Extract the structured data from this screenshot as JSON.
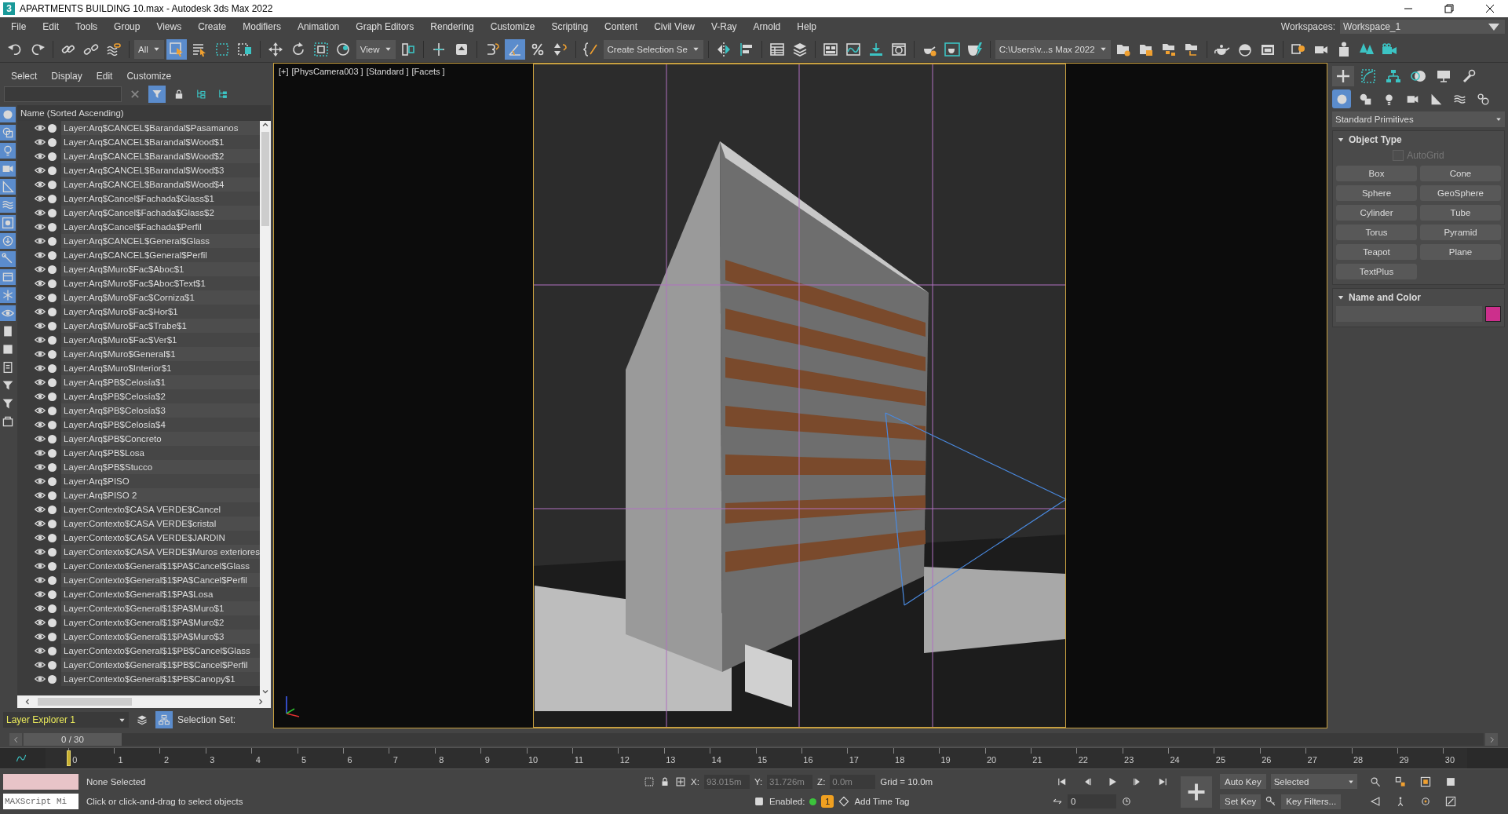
{
  "window": {
    "logo_text": "3",
    "title": "APARTMENTS BUILDING 10.max - Autodesk 3ds Max 2022"
  },
  "menu": [
    "File",
    "Edit",
    "Tools",
    "Group",
    "Views",
    "Create",
    "Modifiers",
    "Animation",
    "Graph Editors",
    "Rendering",
    "Customize",
    "Scripting",
    "Content",
    "Civil View",
    "V-Ray",
    "Arnold",
    "Help"
  ],
  "workspaces": {
    "label": "Workspaces:",
    "value": "Workspace_1"
  },
  "toolbar": [
    [
      {
        "kind": "button",
        "selected": false
      },
      {
        "kind": "button",
        "selected": false
      }
    ],
    [
      {
        "kind": "button",
        "selected": false
      },
      {
        "kind": "button",
        "selected": false
      },
      {
        "kind": "button",
        "selected": false
      }
    ],
    [
      {
        "kind": "dropdown",
        "value": "All"
      },
      {
        "kind": "button",
        "selected": true
      },
      {
        "kind": "button",
        "selected": false
      },
      {
        "kind": "button",
        "selected": false
      },
      {
        "kind": "button",
        "selected": false
      }
    ],
    [
      {
        "kind": "button",
        "selected": false
      },
      {
        "kind": "button",
        "selected": false
      },
      {
        "kind": "button",
        "selected": false
      },
      {
        "kind": "button",
        "selected": false
      },
      {
        "kind": "dropdown",
        "value": "View"
      },
      {
        "kind": "button",
        "selected": false
      }
    ],
    [
      {
        "kind": "button",
        "selected": false
      },
      {
        "kind": "button",
        "selected": false
      }
    ],
    [
      {
        "kind": "button",
        "selected": false
      },
      {
        "kind": "button",
        "selected": true
      },
      {
        "kind": "button",
        "selected": false
      },
      {
        "kind": "button",
        "selected": false
      }
    ],
    [
      {
        "kind": "button",
        "selected": false
      },
      {
        "kind": "dropdown",
        "value": "Create Selection Se"
      }
    ],
    [
      {
        "kind": "button",
        "selected": false
      },
      {
        "kind": "button",
        "selected": false
      }
    ],
    [
      {
        "kind": "button",
        "selected": false
      },
      {
        "kind": "button",
        "selected": false
      }
    ],
    [
      {
        "kind": "button",
        "selected": false
      },
      {
        "kind": "button",
        "selected": false
      },
      {
        "kind": "button",
        "selected": false
      },
      {
        "kind": "button",
        "selected": false
      }
    ],
    [
      {
        "kind": "button",
        "selected": false
      },
      {
        "kind": "button",
        "selected": false
      },
      {
        "kind": "button",
        "selected": false
      }
    ],
    [
      {
        "kind": "dropdown",
        "value": "C:\\Users\\v...s Max 2022"
      },
      {
        "kind": "button",
        "selected": false
      },
      {
        "kind": "button",
        "selected": false
      },
      {
        "kind": "button",
        "selected": false
      },
      {
        "kind": "button",
        "selected": false
      }
    ],
    [
      {
        "kind": "button",
        "selected": false
      },
      {
        "kind": "button",
        "selected": false
      },
      {
        "kind": "button",
        "selected": false
      }
    ],
    [
      {
        "kind": "button",
        "selected": false
      },
      {
        "kind": "button",
        "selected": false
      },
      {
        "kind": "button",
        "selected": false
      },
      {
        "kind": "button",
        "selected": false
      },
      {
        "kind": "button",
        "selected": false
      }
    ]
  ],
  "scene_explorer": {
    "menu": [
      "Select",
      "Display",
      "Edit",
      "Customize"
    ],
    "tools": [
      {
        "selected": true
      },
      {
        "selected": false
      },
      {
        "selected": false
      },
      {
        "selected": false
      }
    ],
    "filters": [
      {
        "on": true
      },
      {
        "on": true
      },
      {
        "on": true
      },
      {
        "on": true
      },
      {
        "on": true
      },
      {
        "on": true
      },
      {
        "on": true
      },
      {
        "on": true
      },
      {
        "on": true
      },
      {
        "on": true
      },
      {
        "on": true
      },
      {
        "on": true
      },
      {
        "on": false
      },
      {
        "on": false
      },
      {
        "on": false
      },
      {
        "on": false
      },
      {
        "on": false
      },
      {
        "on": false
      }
    ],
    "column": "Name (Sorted Ascending)",
    "rows": [
      {
        "name": "Layer:Arq$CANCEL$Barandal$Pasamanos",
        "visible": true
      },
      {
        "name": "Layer:Arq$CANCEL$Barandal$Wood$1",
        "visible": true
      },
      {
        "name": "Layer:Arq$CANCEL$Barandal$Wood$2",
        "visible": true
      },
      {
        "name": "Layer:Arq$CANCEL$Barandal$Wood$3",
        "visible": true
      },
      {
        "name": "Layer:Arq$CANCEL$Barandal$Wood$4",
        "visible": true
      },
      {
        "name": "Layer:Arq$Cancel$Fachada$Glass$1",
        "visible": true
      },
      {
        "name": "Layer:Arq$Cancel$Fachada$Glass$2",
        "visible": true
      },
      {
        "name": "Layer:Arq$Cancel$Fachada$Perfil",
        "visible": true
      },
      {
        "name": "Layer:Arq$CANCEL$General$Glass",
        "visible": true
      },
      {
        "name": "Layer:Arq$CANCEL$General$Perfil",
        "visible": true
      },
      {
        "name": "Layer:Arq$Muro$Fac$Aboc$1",
        "visible": true
      },
      {
        "name": "Layer:Arq$Muro$Fac$Aboc$Text$1",
        "visible": true
      },
      {
        "name": "Layer:Arq$Muro$Fac$Corniza$1",
        "visible": true
      },
      {
        "name": "Layer:Arq$Muro$Fac$Hor$1",
        "visible": true
      },
      {
        "name": "Layer:Arq$Muro$Fac$Trabe$1",
        "visible": true
      },
      {
        "name": "Layer:Arq$Muro$Fac$Ver$1",
        "visible": true
      },
      {
        "name": "Layer:Arq$Muro$General$1",
        "visible": true
      },
      {
        "name": "Layer:Arq$Muro$Interior$1",
        "visible": true
      },
      {
        "name": "Layer:Arq$PB$Celosía$1",
        "visible": true
      },
      {
        "name": "Layer:Arq$PB$Celosía$2",
        "visible": true
      },
      {
        "name": "Layer:Arq$PB$Celosía$3",
        "visible": true
      },
      {
        "name": "Layer:Arq$PB$Celosía$4",
        "visible": true
      },
      {
        "name": "Layer:Arq$PB$Concreto",
        "visible": true
      },
      {
        "name": "Layer:Arq$PB$Losa",
        "visible": true
      },
      {
        "name": "Layer:Arq$PB$Stucco",
        "visible": true
      },
      {
        "name": "Layer:Arq$PISO",
        "visible": true
      },
      {
        "name": "Layer:Arq$PISO 2",
        "visible": true
      },
      {
        "name": "Layer:Contexto$CASA VERDE$Cancel",
        "visible": true
      },
      {
        "name": "Layer:Contexto$CASA VERDE$cristal",
        "visible": true
      },
      {
        "name": "Layer:Contexto$CASA VERDE$JARDIN",
        "visible": true
      },
      {
        "name": "Layer:Contexto$CASA VERDE$Muros exteriores",
        "visible": true
      },
      {
        "name": "Layer:Contexto$General$1$PA$Cancel$Glass",
        "visible": true
      },
      {
        "name": "Layer:Contexto$General$1$PA$Cancel$Perfil",
        "visible": true
      },
      {
        "name": "Layer:Contexto$General$1$PA$Losa",
        "visible": true
      },
      {
        "name": "Layer:Contexto$General$1$PA$Muro$1",
        "visible": true
      },
      {
        "name": "Layer:Contexto$General$1$PA$Muro$2",
        "visible": true
      },
      {
        "name": "Layer:Contexto$General$1$PA$Muro$3",
        "visible": true
      },
      {
        "name": "Layer:Contexto$General$1$PB$Cancel$Glass",
        "visible": true
      },
      {
        "name": "Layer:Contexto$General$1$PB$Cancel$Perfil",
        "visible": true
      },
      {
        "name": "Layer:Contexto$General$1$PB$Canopy$1",
        "visible": true
      }
    ],
    "explorer": "Layer Explorer 1",
    "explorer_tools": [
      {
        "selected": false
      },
      {
        "selected": true
      }
    ],
    "selection_set_label": "Selection Set:"
  },
  "viewport": {
    "labels": [
      "[+]",
      "[PhysCamera003 ]",
      "[Standard ]",
      "[Facets ]"
    ],
    "kind": "picture"
  },
  "command_panel": {
    "tabs": [
      {
        "selected": true
      },
      {
        "selected": false
      },
      {
        "selected": false
      },
      {
        "selected": false
      },
      {
        "selected": false
      },
      {
        "selected": false
      }
    ],
    "categories": [
      {
        "selected": true
      },
      {
        "selected": false
      },
      {
        "selected": false
      },
      {
        "selected": false
      },
      {
        "selected": false
      },
      {
        "selected": false
      },
      {
        "selected": false
      }
    ],
    "dropdown": "Standard Primitives",
    "rollouts": [
      {
        "kind": "object_type",
        "title": "Object Type",
        "expanded": true,
        "autogrid": {
          "label": "AutoGrid",
          "checked": false,
          "disabled": true
        },
        "buttons": [
          "Box",
          "Cone",
          "Sphere",
          "GeoSphere",
          "Cylinder",
          "Tube",
          "Torus",
          "Pyramid",
          "Teapot",
          "Plane",
          "TextPlus"
        ]
      },
      {
        "kind": "name_color",
        "title": "Name and Color",
        "expanded": true,
        "color": "#cc2f8c"
      }
    ]
  },
  "time_slider": {
    "label": "0 / 30",
    "level": 0
  },
  "track_bar": {
    "ticks": [
      "0",
      "1",
      "2",
      "3",
      "4",
      "5",
      "6",
      "7",
      "8",
      "9",
      "10",
      "11",
      "12",
      "13",
      "14",
      "15",
      "16",
      "17",
      "18",
      "19",
      "20",
      "21",
      "22",
      "23",
      "24",
      "25",
      "26",
      "27",
      "28",
      "29",
      "30"
    ],
    "level": 0
  },
  "status": {
    "maxscript": "MAXScript Mi",
    "selection": "None Selected",
    "prompt": "Click or click-and-drag to select objects",
    "x_label": "X:",
    "x": "93.015m",
    "y_label": "Y:",
    "y": "31.726m",
    "z_label": "Z:",
    "z": "0.0m",
    "grid": "Grid = 10.0m",
    "enabled_label": "Enabled:",
    "enabled_badge": "1",
    "time_tag": "Add Time Tag",
    "frame": "0",
    "auto_key": "Auto Key",
    "key_mode": "Selected",
    "set_key": "Set Key",
    "key_filters": "Key Filters..."
  }
}
